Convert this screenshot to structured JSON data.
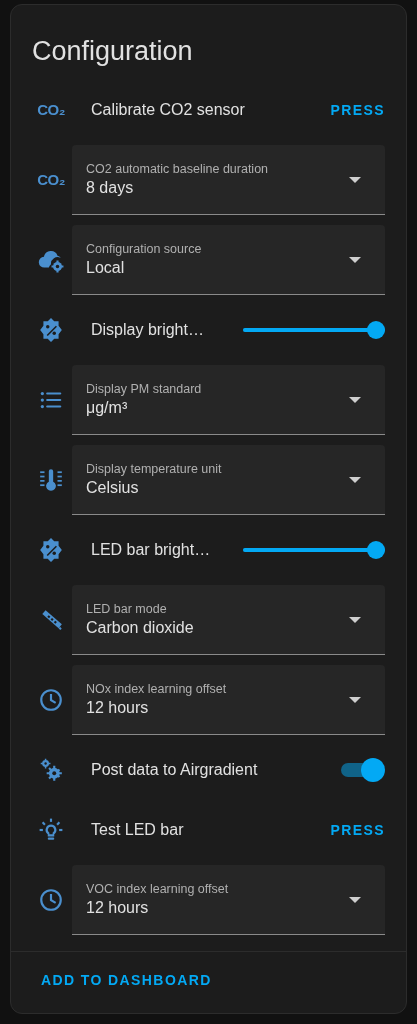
{
  "card": {
    "title": "Configuration",
    "entities": [
      {
        "kind": "button",
        "icon_text": "CO₂",
        "label": "Calibrate CO2 sensor",
        "action": "PRESS"
      },
      {
        "kind": "select",
        "icon_text": "CO₂",
        "label": "CO2 automatic baseline duration",
        "value": "8 days"
      },
      {
        "kind": "select",
        "label": "Configuration source",
        "value": "Local"
      },
      {
        "kind": "slider",
        "label": "Display bright…",
        "level": 1.0
      },
      {
        "kind": "select",
        "label": "Display PM standard",
        "value": "μg/m³"
      },
      {
        "kind": "select",
        "label": "Display temperature unit",
        "value": "Celsius"
      },
      {
        "kind": "slider",
        "label": "LED bar bright…",
        "level": 1.0
      },
      {
        "kind": "select",
        "label": "LED bar mode",
        "value": "Carbon dioxide"
      },
      {
        "kind": "select",
        "label": "NOx index learning offset",
        "value": "12 hours"
      },
      {
        "kind": "toggle",
        "label": "Post data to Airgradient",
        "on": true
      },
      {
        "kind": "button",
        "label": "Test LED bar",
        "action": "PRESS"
      },
      {
        "kind": "select",
        "label": "VOC index learning offset",
        "value": "12 hours"
      }
    ],
    "footer_action": "ADD TO DASHBOARD"
  }
}
